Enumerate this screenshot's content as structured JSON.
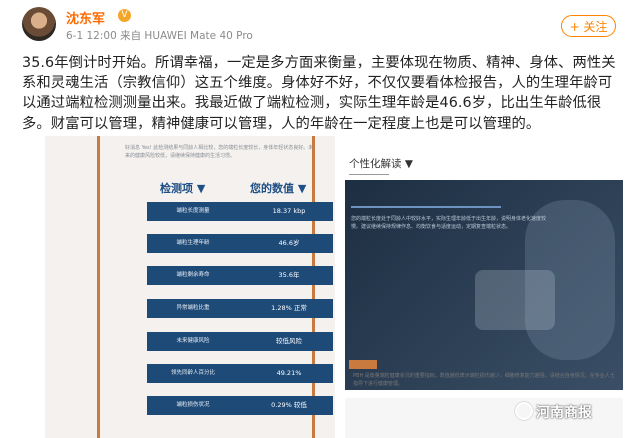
{
  "post": {
    "username": "沈东军",
    "meta": "6-1 12:00  来自 HUAWEI Mate 40 Pro",
    "follow_label": "+ 关注",
    "text": "35.6年倒计时开始。所谓幸福，一定是多方面来衡量，主要体现在物质、精神、身体、两性关系和灵魂生活（宗教信仰）这五个维度。身体好不好，不仅仅要看体检报告，人的生理年龄可以通过端粒检测测量出来。我最近做了端粒检测，实际生理年龄是46.6岁，比出生年龄低很多。财富可以管理，精神健康可以管理，人的年龄在一定程度上也是可以管理的。"
  },
  "report_left": {
    "intro": "好消息 Yes! 此检测结果与同龄人相比较，您的端粒长度较长，身体年轻状态良好。未来的健康风险较低，请继续保持健康的生活习惯。",
    "header_item": "检测项 ▼",
    "header_value": "您的数值 ▼",
    "rows": [
      {
        "key": "端粒长度测量",
        "value": "18.37 kbp"
      },
      {
        "key": "端粒生理年龄",
        "value": "46.6岁"
      },
      {
        "key": "端粒剩余寿命",
        "value": "35.6年"
      },
      {
        "key": "异常端粒比重",
        "value": "1.28% 正常"
      },
      {
        "key": "未来健康风险",
        "value": "较低风险"
      },
      {
        "key": "领先同龄人百分比",
        "value": "49.21%"
      },
      {
        "key": "端粒损伤状况",
        "value": "0.29% 较低"
      }
    ]
  },
  "report_right": {
    "title": "个性化解读 ▼",
    "desc": "您的端粒长度处于同龄人中较好水平，实际生理年龄低于出生年龄，说明身体老化速度较慢。建议继续保持规律作息、均衡饮食与适度运动，定期复查端粒状态。",
    "bottom_text": "PBH 是衡量端粒健康状况的重要指标，数值越低表示端粒损伤越少，细胞修复能力越强。请结合自身情况，在专业人士指导下进行健康管理。"
  },
  "watermark": "河南商报"
}
